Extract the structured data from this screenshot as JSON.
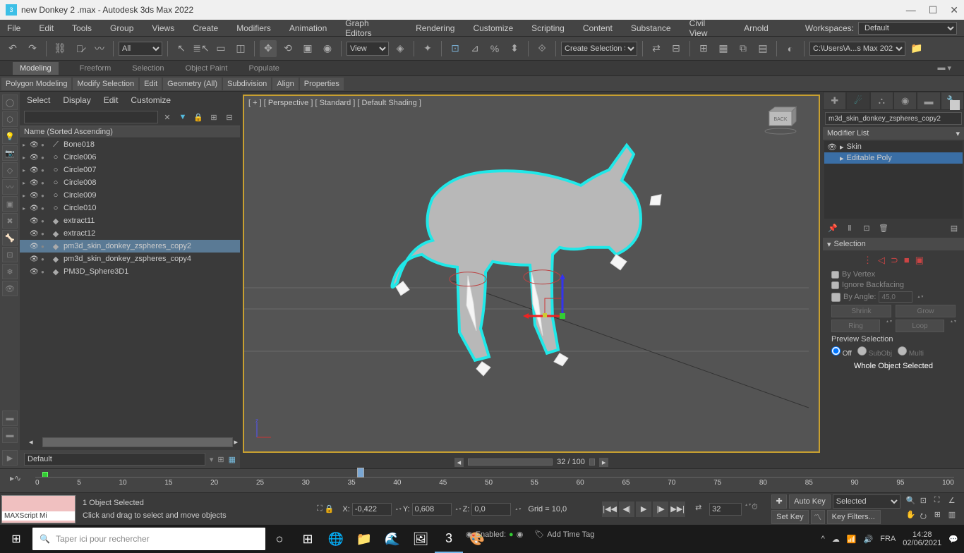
{
  "title": "new Donkey 2 .max - Autodesk 3ds Max 2022",
  "menubar": [
    "File",
    "Edit",
    "Tools",
    "Group",
    "Views",
    "Create",
    "Modifiers",
    "Animation",
    "Graph Editors",
    "Rendering",
    "Customize",
    "Scripting",
    "Content",
    "Substance",
    "Civil View",
    "Arnold"
  ],
  "workspaces_label": "Workspaces:",
  "workspaces_value": "Default",
  "toolbar": {
    "all_filter": "All",
    "view_label": "View",
    "named_sel": "Create Selection Se",
    "project_path": "C:\\Users\\A...s Max 2022"
  },
  "ribbon_tabs": [
    "Modeling",
    "Freeform",
    "Selection",
    "Object Paint",
    "Populate"
  ],
  "ribbon_panels": [
    "Polygon Modeling",
    "Modify Selection",
    "Edit",
    "Geometry (All)",
    "Subdivision",
    "Align",
    "Properties"
  ],
  "explorer": {
    "menu": [
      "Select",
      "Display",
      "Edit",
      "Customize"
    ],
    "header": "Name (Sorted Ascending)",
    "items": [
      {
        "label": "Bone018",
        "type": "bone",
        "expand": true
      },
      {
        "label": "Circle006",
        "type": "shape",
        "expand": true
      },
      {
        "label": "Circle007",
        "type": "shape",
        "expand": true
      },
      {
        "label": "Circle008",
        "type": "shape",
        "expand": true
      },
      {
        "label": "Circle009",
        "type": "shape",
        "expand": true
      },
      {
        "label": "Circle010",
        "type": "shape",
        "expand": true
      },
      {
        "label": "extract11",
        "type": "mesh",
        "expand": false
      },
      {
        "label": "extract12",
        "type": "mesh",
        "expand": false
      },
      {
        "label": "pm3d_skin_donkey_zspheres_copy2",
        "type": "mesh",
        "expand": false,
        "selected": true
      },
      {
        "label": "pm3d_skin_donkey_zspheres_copy4",
        "type": "mesh",
        "expand": false
      },
      {
        "label": "PM3D_Sphere3D1",
        "type": "mesh",
        "expand": false
      }
    ],
    "layer": "Default"
  },
  "viewport": {
    "label": "[ + ] [ Perspective ] [ Standard ] [ Default Shading ]",
    "cube_face": "BACK",
    "slider": "32 / 100"
  },
  "cmdpanel": {
    "obj_name": "m3d_skin_donkey_zspheres_copy2",
    "mod_list_label": "Modifier List",
    "stack": [
      {
        "label": "Skin",
        "sel": false
      },
      {
        "label": "Editable Poly",
        "sel": true
      }
    ],
    "rollout": {
      "title": "Selection",
      "by_vertex": "By Vertex",
      "ignore_backfacing": "Ignore Backfacing",
      "by_angle": "By Angle:",
      "angle_val": "45,0",
      "shrink": "Shrink",
      "grow": "Grow",
      "ring": "Ring",
      "loop": "Loop",
      "preview_label": "Preview Selection",
      "off": "Off",
      "subobj": "SubObj",
      "multi": "Multi",
      "whole": "Whole Object Selected"
    }
  },
  "timeline": {
    "ticks": [
      "0",
      "5",
      "10",
      "15",
      "20",
      "25",
      "30",
      "35",
      "40",
      "45",
      "50",
      "55",
      "60",
      "65",
      "70",
      "75",
      "80",
      "85",
      "90",
      "95",
      "100"
    ]
  },
  "statusbar": {
    "script_placeholder": "MAXScript Mi",
    "sel_msg": "1 Object Selected",
    "hint": "Click and drag to select and move objects",
    "x": "-0,422",
    "y": "0,608",
    "z": "0,0",
    "grid": "Grid = 10,0",
    "enabled": "Enabled:",
    "add_time_tag": "Add Time Tag",
    "frame": "32",
    "autokey": "Auto Key",
    "setkey": "Set Key",
    "selected": "Selected",
    "keyfilters": "Key Filters..."
  },
  "taskbar": {
    "search": "Taper ici pour rechercher",
    "lang": "FRA",
    "time": "14:28",
    "date": "02/06/2021"
  }
}
